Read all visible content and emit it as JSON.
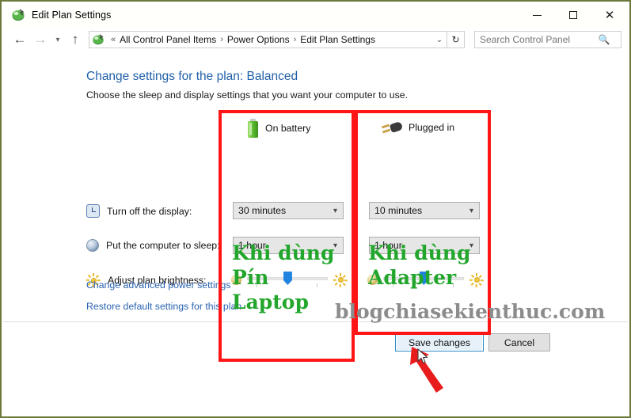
{
  "window": {
    "title": "Edit Plan Settings",
    "icon": "power-plan-icon",
    "minimize_label": "Minimize",
    "maximize_label": "Maximize",
    "close_label": "Close"
  },
  "nav": {
    "back_label": "Back",
    "forward_label": "Forward",
    "recent_label": "Recent pages",
    "up_label": "Up one level",
    "breadcrumbs": [
      {
        "label": "All Control Panel Items"
      },
      {
        "label": "Power Options"
      },
      {
        "label": "Edit Plan Settings"
      }
    ],
    "breadcrumb_prefix": "«",
    "separator": "›",
    "dropdown_glyph": "⌄",
    "refresh_glyph": "↻",
    "search": {
      "placeholder": "Search Control Panel",
      "value": "",
      "icon": "search-icon"
    }
  },
  "main": {
    "title": "Change settings for the plan: Balanced",
    "subtitle": "Choose the sleep and display settings that you want your computer to use.",
    "columns": [
      {
        "key": "battery",
        "label": "On battery",
        "icon": "battery-icon"
      },
      {
        "key": "plugged",
        "label": "Plugged in",
        "icon": "power-plug-icon"
      }
    ],
    "rows": [
      {
        "label": "Turn off the display:",
        "icon": "clock-icon",
        "battery_value": "30 minutes",
        "plugged_value": "10 minutes"
      },
      {
        "label": "Put the computer to sleep:",
        "icon": "sleep-icon",
        "battery_value": "1 hour",
        "plugged_value": "1 hour"
      },
      {
        "label": "Adjust plan brightness:",
        "icon": "brightness-icon",
        "battery_slider_percent": 45,
        "plugged_slider_percent": 45
      }
    ],
    "links": [
      {
        "label": "Change advanced power settings"
      },
      {
        "label": "Restore default settings for this plan"
      }
    ],
    "buttons": {
      "save": "Save changes",
      "cancel": "Cancel"
    }
  },
  "annotations": {
    "highlight_color": "#ff1515",
    "note_color": "#22a62b",
    "note_left": [
      "Khi dùng",
      "Pín",
      "Laptop"
    ],
    "note_right": [
      "Khi dùng",
      "Adapter"
    ],
    "watermark": "blogchiasekienthuc.com",
    "arrow_target": "Save changes"
  }
}
